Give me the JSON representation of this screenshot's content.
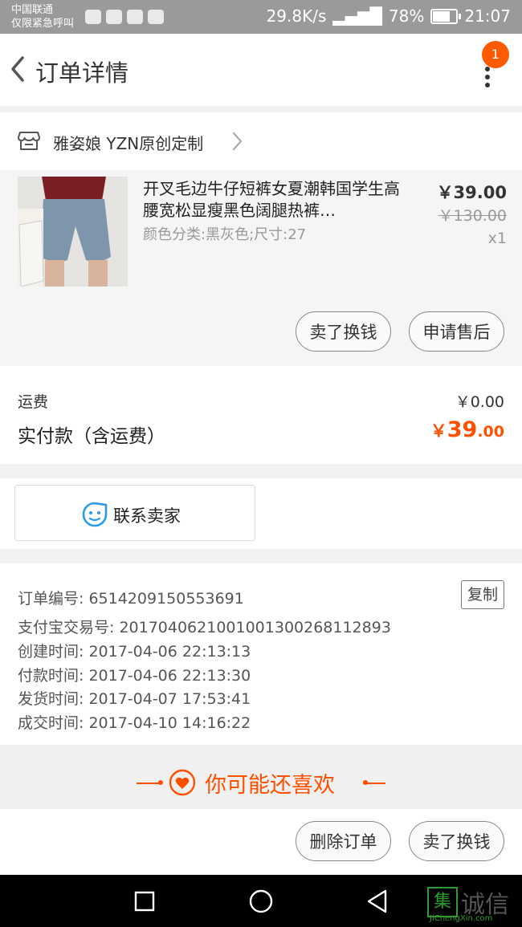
{
  "status_bar": {
    "carrier_line1": "中国联通",
    "carrier_line2": "仅限紧急呼叫",
    "speed": "29.8K/s",
    "battery": "78%",
    "time": "21:07"
  },
  "header": {
    "title": "订单详情",
    "badge_count": "1"
  },
  "shop": {
    "name": "雅姿娘 YZN原创定制"
  },
  "product": {
    "title": "开叉毛边牛仔短裤女夏潮韩国学生高腰宽松显瘦黑色阔腿热裤…",
    "sku": "颜色分类:黑灰色;尺寸:27",
    "price": "￥39.00",
    "original_price": "￥130.00",
    "quantity": "x1",
    "sell_button": "卖了换钱",
    "aftersale_button": "申请售后"
  },
  "totals": {
    "shipping_label": "运费",
    "shipping_value": "￥0.00",
    "paid_label": "实付款（含运费）",
    "paid_currency": "￥",
    "paid_int": "39",
    "paid_dec": ".00"
  },
  "contact": {
    "label": "联系卖家"
  },
  "order_info": {
    "copy_button": "复制",
    "lines": [
      "订单编号: 6514209150553691",
      "支付宝交易号: 2017040621001001300268112893",
      "创建时间: 2017-04-06 22:13:13",
      "付款时间: 2017-04-06 22:13:30",
      "发货时间: 2017-04-07 17:53:41",
      "成交时间: 2017-04-10 14:16:22"
    ]
  },
  "recommend": {
    "label": "你可能还喜欢"
  },
  "actions": {
    "delete_button": "删除订单",
    "sell_button": "卖了换钱"
  },
  "watermark": {
    "mark": "集",
    "text": "诚信",
    "sub": "JiChengXin.com"
  },
  "colors": {
    "accent": "#ff5000",
    "badge": "#ff5a00",
    "contact_icon": "#2b9ae8"
  }
}
